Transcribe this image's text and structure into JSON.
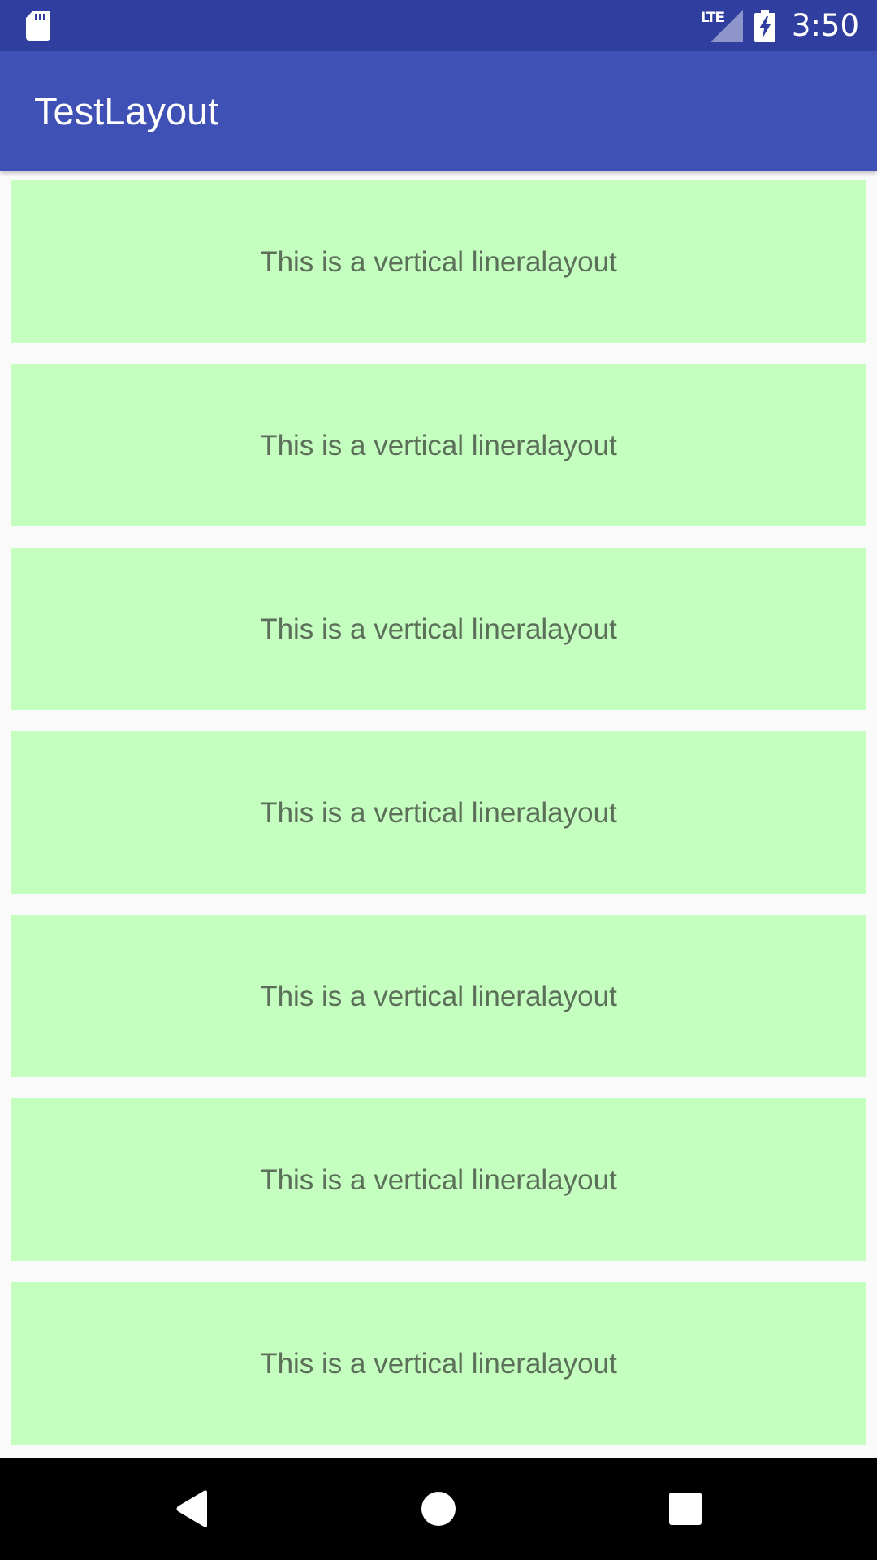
{
  "status_bar": {
    "network_label": "LTE",
    "time": "3:50",
    "icons": [
      "sd-card-icon",
      "signal-icon",
      "battery-charging-icon"
    ]
  },
  "app_bar": {
    "title": "TestLayout",
    "color": "#3f51b5"
  },
  "list": {
    "item_color": "#c4ffc0",
    "items": [
      {
        "label": "This is a vertical lineralayout"
      },
      {
        "label": "This is a vertical lineralayout"
      },
      {
        "label": "This is a vertical lineralayout"
      },
      {
        "label": "This is a vertical lineralayout"
      },
      {
        "label": "This is a vertical lineralayout"
      },
      {
        "label": "This is a vertical lineralayout"
      },
      {
        "label": "This is a vertical lineralayout"
      }
    ]
  },
  "nav_bar": {
    "buttons": [
      "back-icon",
      "home-icon",
      "recents-icon"
    ]
  }
}
